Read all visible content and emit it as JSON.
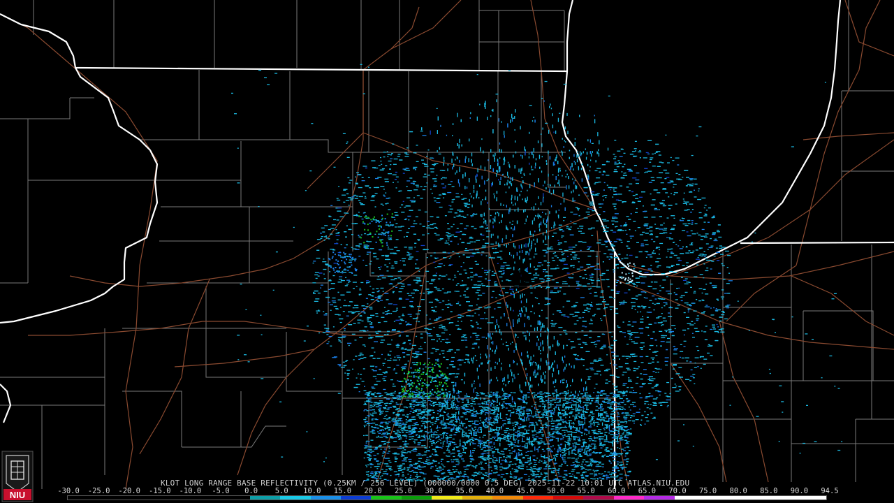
{
  "product": {
    "label": "KLOT LONG RANGE BASE REFLECTIVITY (0.25KM / 256 LEVEL) (000000/0000 0.5 DEG) 2025-11-22 10:01 UTC  ATLAS.NIU.EDU"
  },
  "logo": {
    "text": "NIU",
    "color": "#c8102e"
  },
  "color_scale": {
    "labels": [
      "-30.0",
      "-25.0",
      "-20.0",
      "-15.0",
      "-10.0",
      "-5.0",
      "0.0",
      "5.0",
      "10.0",
      "15.0",
      "20.0",
      "25.0",
      "30.0",
      "35.0",
      "40.0",
      "45.0",
      "50.0",
      "55.0",
      "60.0",
      "65.0",
      "70.0",
      "75.0",
      "80.0",
      "85.0",
      "90.0",
      "94.5"
    ],
    "colors": [
      "#000000",
      "#000000",
      "#000000",
      "#000000",
      "#000000",
      "#000000",
      "#0d9fa8",
      "#19c9e6",
      "#1a8fe8",
      "#0c3cd4",
      "#18c418",
      "#0a9d0a",
      "#f2ea19",
      "#e3b00c",
      "#f28a0a",
      "#ff2a0a",
      "#d40a0a",
      "#b00a4a",
      "#ff2ac8",
      "#b52ae6",
      "#ffffff",
      "#ffffff",
      "#ffffff",
      "#ffffff",
      "#ffffff"
    ]
  },
  "map": {
    "colors": {
      "background": "#000000",
      "state_lines": "#ffffff",
      "county_lines": "#8a8a8a",
      "highways": "#9a5a3a",
      "echo_light": "#1ab8e0",
      "echo_mid": "#1a7fe8",
      "echo_deep": "#1240c8",
      "echo_green": "#19c020"
    },
    "echo_clusters": [
      {
        "name": "main",
        "lat_frac": 0.5,
        "density": "high"
      }
    ]
  }
}
